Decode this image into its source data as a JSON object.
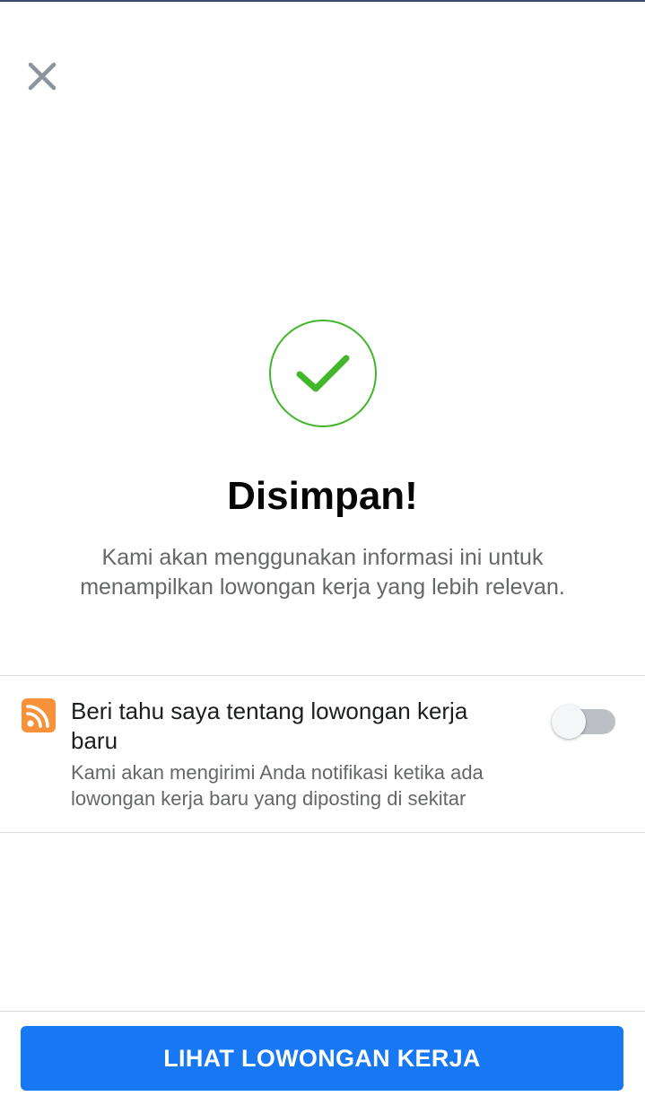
{
  "header": {
    "close_icon": "close-icon"
  },
  "confirmation": {
    "icon": "checkmark-circle-icon",
    "title": "Disimpan!",
    "description": "Kami akan menggunakan informasi ini untuk menampilkan lowongan kerja yang lebih relevan."
  },
  "notification_setting": {
    "icon": "rss-feed-icon",
    "title": "Beri tahu saya tentang lowongan kerja baru",
    "subtitle": "Kami akan mengirimi Anda notifikasi ketika ada lowongan kerja baru yang diposting di sekitar",
    "toggle_on": false
  },
  "footer": {
    "button_label": "LIHAT LOWONGAN KERJA"
  },
  "colors": {
    "accent_blue": "#1877f2",
    "success_green": "#42b72a",
    "rss_orange": "#f7923a",
    "secondary_text": "#65676b"
  }
}
